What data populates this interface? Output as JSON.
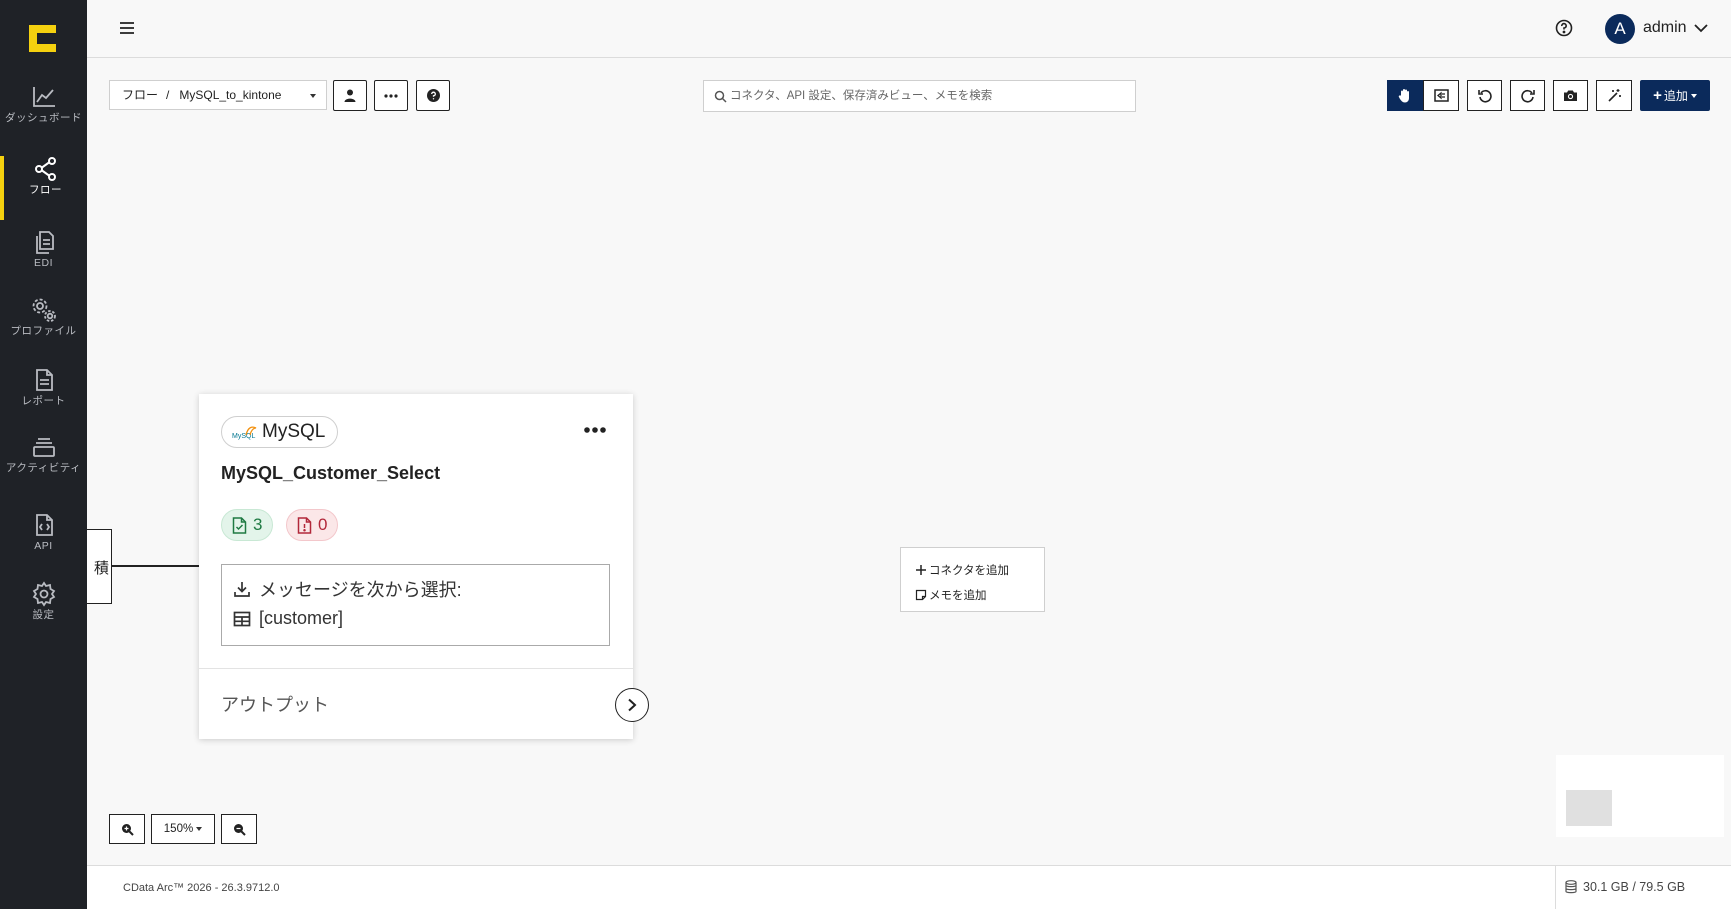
{
  "sidebar": {
    "items": [
      {
        "label": "ダッシュボード",
        "icon": "chart-line-icon"
      },
      {
        "label": "フロー",
        "icon": "share-nodes-icon",
        "active": true
      },
      {
        "label": "EDI",
        "icon": "documents-icon"
      },
      {
        "label": "プロファイル",
        "icon": "gears-icon"
      },
      {
        "label": "レポート",
        "icon": "report-icon"
      },
      {
        "label": "アクティビティ",
        "icon": "activity-icon"
      },
      {
        "label": "API",
        "icon": "api-icon"
      },
      {
        "label": "設定",
        "icon": "gear-icon"
      }
    ],
    "active_color": "#f5d10f"
  },
  "header": {
    "user": {
      "initial": "A",
      "name": "admin"
    }
  },
  "toolbar": {
    "breadcrumb_root": "フロー",
    "breadcrumb_separator": "/",
    "flow_name": "MySQL_to_kintone",
    "search_placeholder": "コネクタ、API 設定、保存済みビュー、メモを検索",
    "add_label": "追加"
  },
  "canvas": {
    "left_node_text": "積",
    "card": {
      "connector_type": "MySQL",
      "logo_text": "MySQL",
      "title": "MySQL_Customer_Select",
      "success_count": "3",
      "error_count": "0",
      "select_label": "メッセージを次から選択:",
      "table_name": "[customer]",
      "output_label": "アウトプット"
    },
    "context_menu": [
      {
        "label": "コネクタを追加",
        "icon": "plus-icon"
      },
      {
        "label": "メモを追加",
        "icon": "note-icon"
      }
    ],
    "zoom": "150%"
  },
  "footer": {
    "version": "CData Arc™ 2026 - 26.3.9712.0",
    "storage": "30.1 GB / 79.5 GB"
  },
  "colors": {
    "sidebar_bg": "#1f2227",
    "primary": "#0b2a5b",
    "success": "#1f7a43",
    "error": "#b2283a"
  }
}
